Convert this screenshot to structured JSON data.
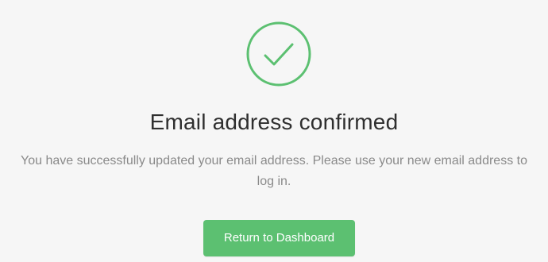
{
  "confirmation": {
    "icon": "check-circle-icon",
    "title": "Email address confirmed",
    "message": "You have successfully updated your email address. Please use your new email address to log in.",
    "button_label": "Return to Dashboard"
  },
  "colors": {
    "accent": "#5cc071",
    "background": "#f6f6f6",
    "title": "#2f2f2f",
    "message": "#8a8a8a"
  }
}
